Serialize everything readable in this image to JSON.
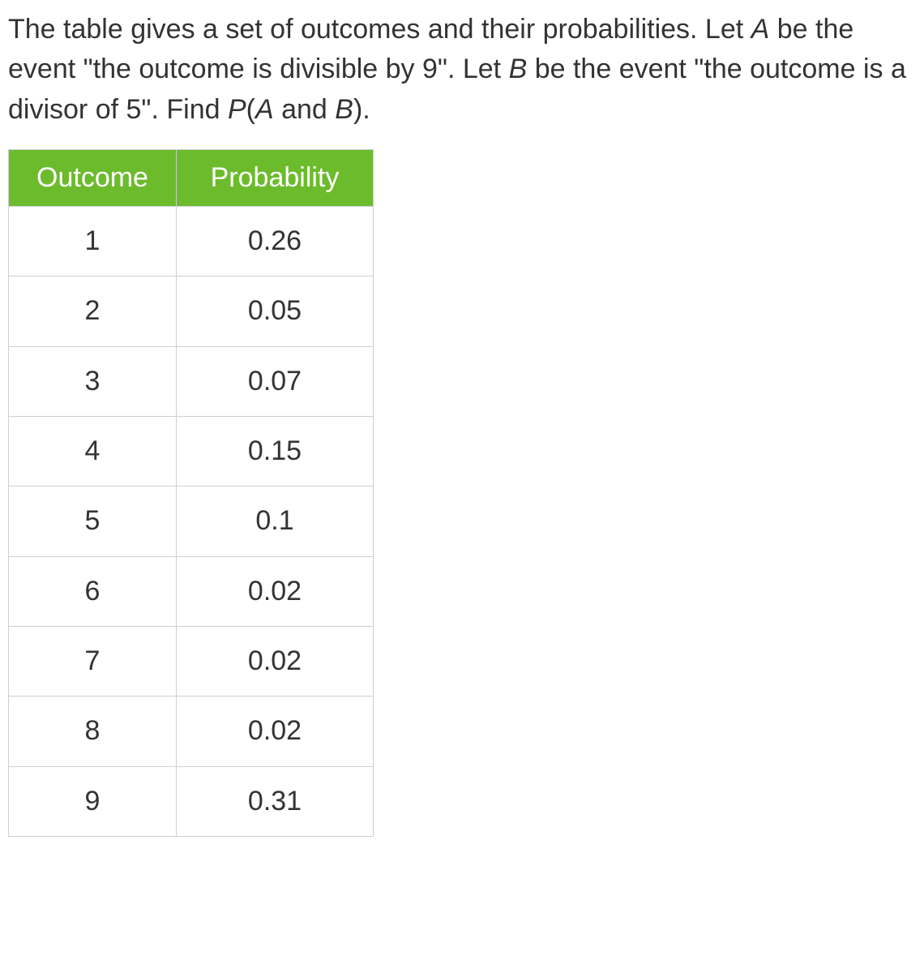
{
  "question": {
    "sentence1_a": "The table gives a set of outcomes and their probabilities. Let ",
    "A": "A",
    "sentence1_b": " be the event \"the outcome is divisible by 9\". Let ",
    "B": "B",
    "sentence1_c": " be the event \"the outcome is a divisor of 5\". Find ",
    "P_open": "P",
    "paren_open": "(",
    "A2": "A",
    "and_word": " and ",
    "B2": "B",
    "paren_close": ").",
    "close": ""
  },
  "table": {
    "headers": [
      "Outcome",
      "Probability"
    ],
    "rows": [
      {
        "outcome": "1",
        "probability": "0.26"
      },
      {
        "outcome": "2",
        "probability": "0.05"
      },
      {
        "outcome": "3",
        "probability": "0.07"
      },
      {
        "outcome": "4",
        "probability": "0.15"
      },
      {
        "outcome": "5",
        "probability": "0.1"
      },
      {
        "outcome": "6",
        "probability": "0.02"
      },
      {
        "outcome": "7",
        "probability": "0.02"
      },
      {
        "outcome": "8",
        "probability": "0.02"
      },
      {
        "outcome": "9",
        "probability": "0.31"
      }
    ]
  }
}
